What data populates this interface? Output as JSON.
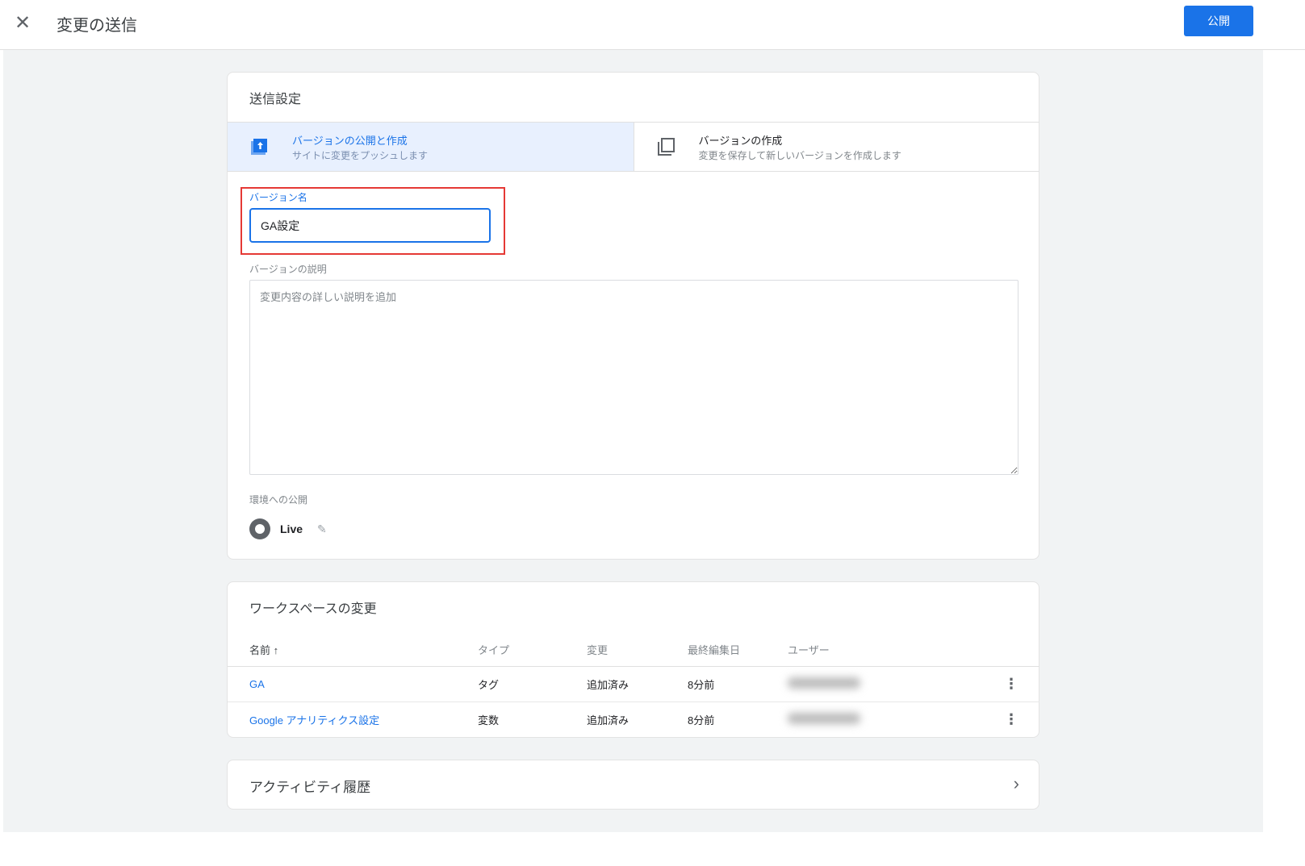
{
  "header": {
    "title": "変更の送信",
    "publish_label": "公開"
  },
  "settings": {
    "title": "送信設定",
    "options": [
      {
        "title": "バージョンの公開と作成",
        "subtitle": "サイトに変更をプッシュします",
        "selected": true
      },
      {
        "title": "バージョンの作成",
        "subtitle": "変更を保存して新しいバージョンを作成します",
        "selected": false
      }
    ],
    "version_name_label": "バージョン名",
    "version_name_value": "GA設定",
    "description_label": "バージョンの説明",
    "description_placeholder": "変更内容の詳しい説明を追加",
    "environment_label": "環境への公開",
    "environment": "Live"
  },
  "workspace": {
    "title": "ワークスペースの変更",
    "columns": [
      "名前",
      "タイプ",
      "変更",
      "最終編集日",
      "ユーザー"
    ],
    "sort_icon": "arrow-up-icon",
    "rows": [
      {
        "name": "GA",
        "type": "タグ",
        "change": "追加済み",
        "edited": "8分前"
      },
      {
        "name": "Google アナリティクス設定",
        "type": "変数",
        "change": "追加済み",
        "edited": "8分前"
      }
    ]
  },
  "activity": {
    "title": "アクティビティ履歴"
  },
  "colors": {
    "accent": "#1a73e8",
    "highlight": "#e53935"
  }
}
